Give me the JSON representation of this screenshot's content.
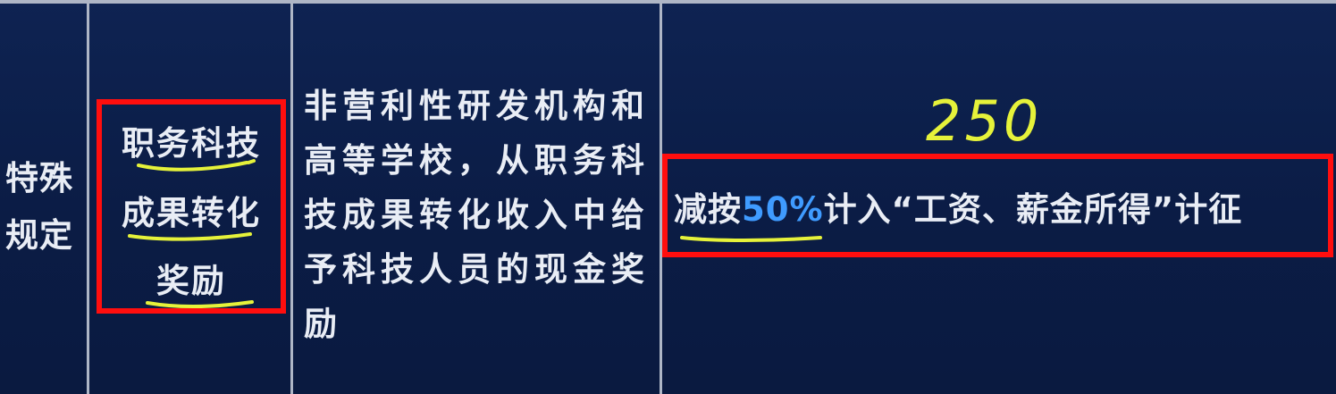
{
  "table": {
    "category": "特殊规定",
    "item": {
      "line1": "职务科技",
      "line2": "成果转化",
      "line3": "奖励"
    },
    "description": "非营利性研发机构和高等学校，从职务科技成果转化收入中给予科技人员的现金奖励",
    "rule": {
      "before": "减按",
      "highlight": "50%",
      "after": "计入“工资、薪金所得”计征"
    }
  },
  "annotations": {
    "handwritten_note": "250",
    "underline_color": "#e6f23a",
    "box_color": "#ff0e0e"
  },
  "colors": {
    "background": "#0c1e48",
    "text": "#e9edf5",
    "highlight": "#3f9bff",
    "grid": "#aeb6c6"
  }
}
